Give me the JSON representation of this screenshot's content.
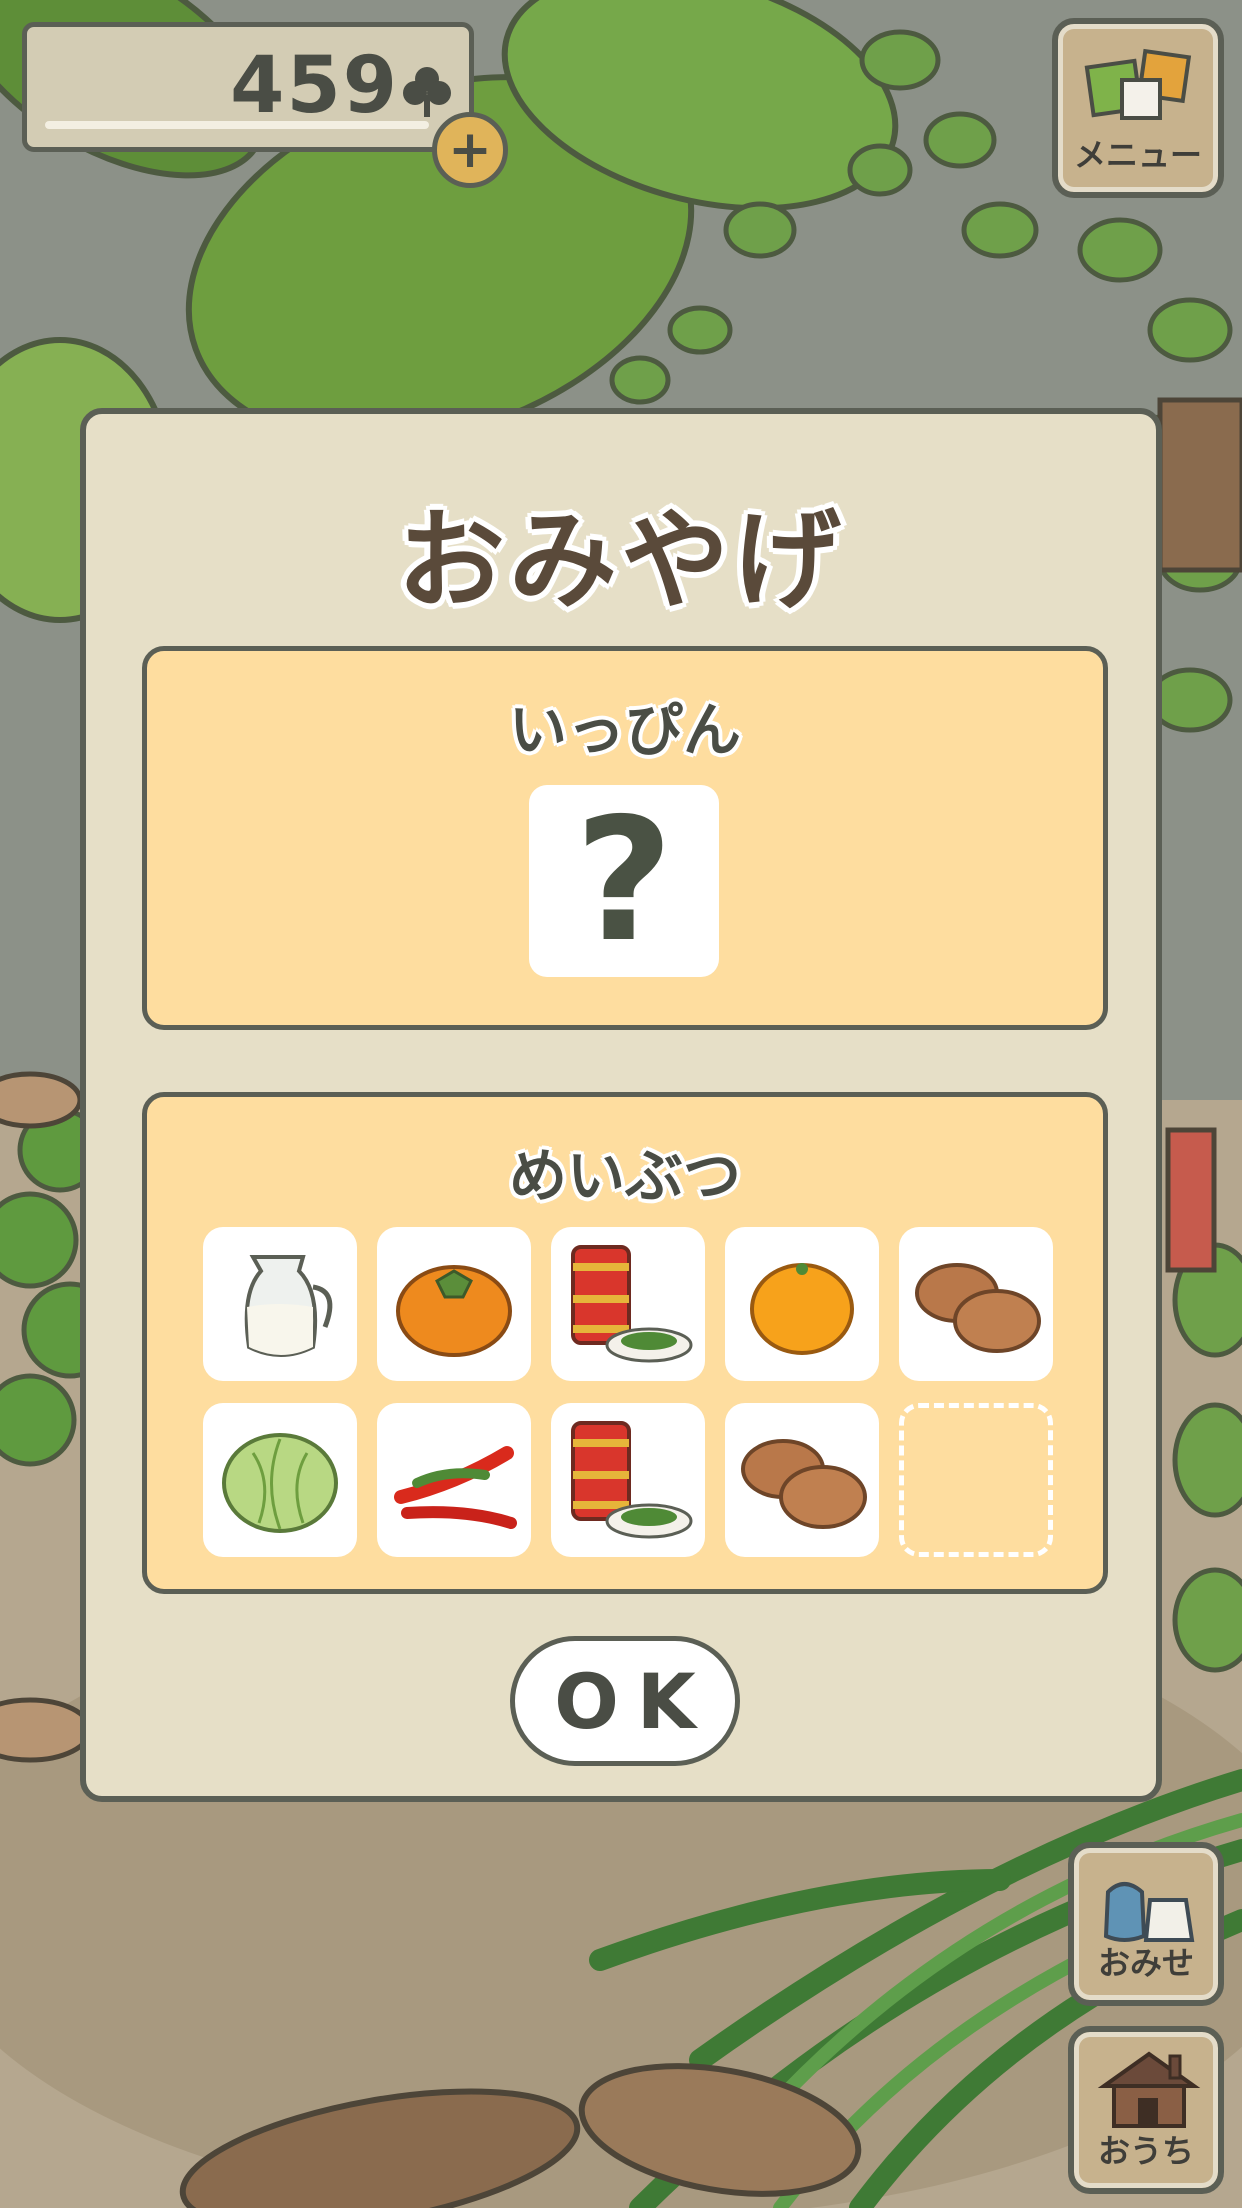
{
  "currency": {
    "amount": "459",
    "icon": "clover-icon"
  },
  "buttons": {
    "menu_label": "メニュー",
    "shop_label": "おみせ",
    "home_label": "おうち",
    "ok_label": "OK"
  },
  "dialog": {
    "title": "おみやげ",
    "special": {
      "title": "いっぴん",
      "item": "?"
    },
    "local": {
      "title": "めいぶつ",
      "items": [
        "milk-jug-icon",
        "persimmon-icon",
        "tea-canister-icon",
        "mandarin-orange-icon",
        "steamed-buns-icon",
        "cabbage-icon",
        "chili-peppers-icon",
        "tea-canister-icon",
        "steamed-buns-icon",
        "empty-slot"
      ]
    }
  },
  "colors": {
    "panel": "#fedd9f",
    "dialog": "#e6dfc7",
    "outline": "#5b5f55",
    "grass": "#6fa04a"
  }
}
